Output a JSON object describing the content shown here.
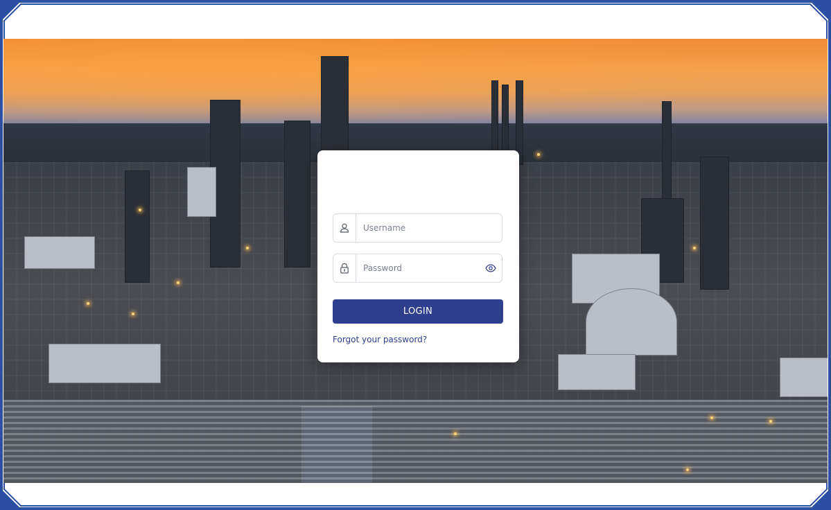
{
  "login": {
    "username_placeholder": "Username",
    "password_placeholder": "Password",
    "login_label": "LOGIN",
    "forgot_label": "Forgot your password?"
  },
  "icons": {
    "username": "user-icon",
    "password": "lock-icon",
    "visibility": "eye-icon"
  },
  "colors": {
    "frame": "#2c4fa3",
    "primary": "#2d3f8e"
  }
}
